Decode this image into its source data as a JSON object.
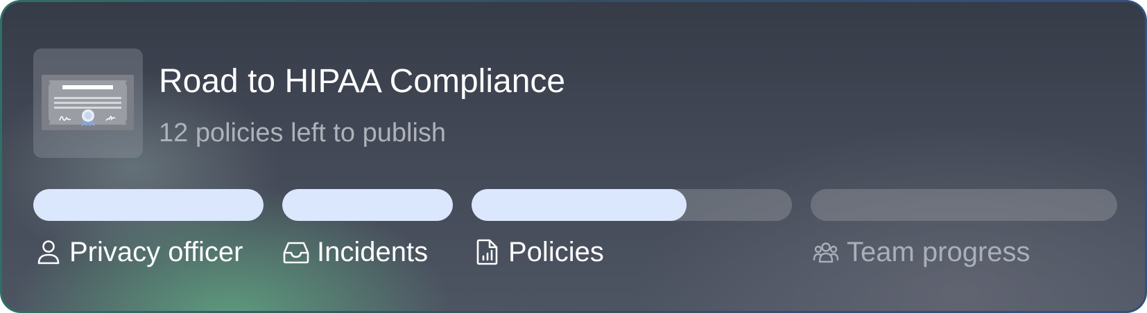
{
  "header": {
    "title": "Road to HIPAA Compliance",
    "subtitle": "12 policies left to publish",
    "badge_icon": "certificate-icon"
  },
  "progress": [
    {
      "id": "privacy",
      "label": "Privacy officer",
      "icon": "user-icon",
      "fill_fraction": 1.0,
      "state": "active"
    },
    {
      "id": "incidents",
      "label": "Incidents",
      "icon": "inbox-tray-icon",
      "fill_fraction": 1.0,
      "state": "active"
    },
    {
      "id": "policies",
      "label": "Policies",
      "icon": "document-chart-icon",
      "fill_fraction": 0.67,
      "state": "active"
    },
    {
      "id": "team",
      "label": "Team progress",
      "icon": "team-users-icon",
      "fill_fraction": 0.0,
      "state": "inactive"
    }
  ],
  "colors": {
    "bar_fill": "#dbe7fd",
    "bar_track": "#6a6f7a",
    "text_primary": "#ffffff",
    "text_muted": "#aab0ba",
    "border_start": "#2f6f69",
    "border_end": "#34507e"
  }
}
